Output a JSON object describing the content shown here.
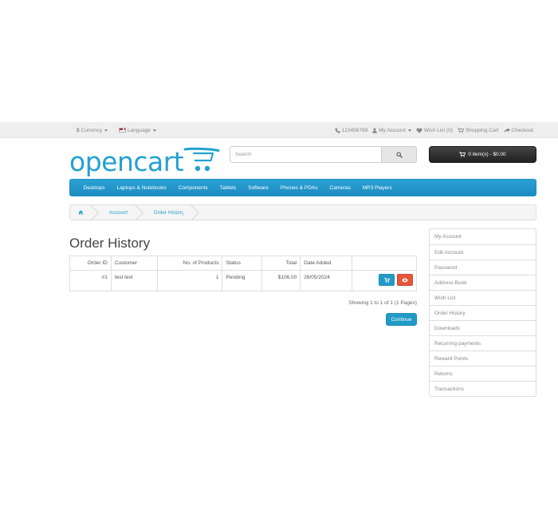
{
  "topbar": {
    "currency_symbol": "$",
    "currency_label": "Currency",
    "language_label": "Language",
    "phone": "123456789",
    "my_account": "My Account",
    "wishlist": "Wish List (0)",
    "shopping_cart": "Shopping Cart",
    "checkout": "Checkout"
  },
  "logo": {
    "text": "opencart",
    "color": "#23a1d1"
  },
  "search": {
    "placeholder": "Search",
    "value": ""
  },
  "cart": {
    "label": "0 item(s) - $0.00"
  },
  "menu": {
    "items": [
      "Desktops",
      "Laptops & Notebooks",
      "Components",
      "Tablets",
      "Software",
      "Phones & PDAs",
      "Cameras",
      "MP3 Players"
    ],
    "color": "#229ac8"
  },
  "breadcrumb": {
    "items": [
      "Account",
      "Order History"
    ]
  },
  "page": {
    "title": "Order History"
  },
  "orders": {
    "headers": [
      "Order ID",
      "Customer",
      "No. of Products",
      "Status",
      "Total",
      "Date Added",
      ""
    ],
    "rows": [
      {
        "order_id": "#1",
        "customer": "test test",
        "products": "1",
        "status": "Pending",
        "total": "$106.00",
        "date": "26/05/2024"
      }
    ]
  },
  "pagination": {
    "showing": "Showing 1 to 1 of 1 (1 Pages)"
  },
  "buttons": {
    "continue": "Continue"
  },
  "sidebar": {
    "items": [
      "My Account",
      "Edit Account",
      "Password",
      "Address Book",
      "Wish List",
      "Order History",
      "Downloads",
      "Recurring payments",
      "Reward Points",
      "Returns",
      "Transactions"
    ]
  },
  "colors": {
    "primary": "#229ac8",
    "danger": "#e5573a",
    "cart_bg": "#333333"
  }
}
